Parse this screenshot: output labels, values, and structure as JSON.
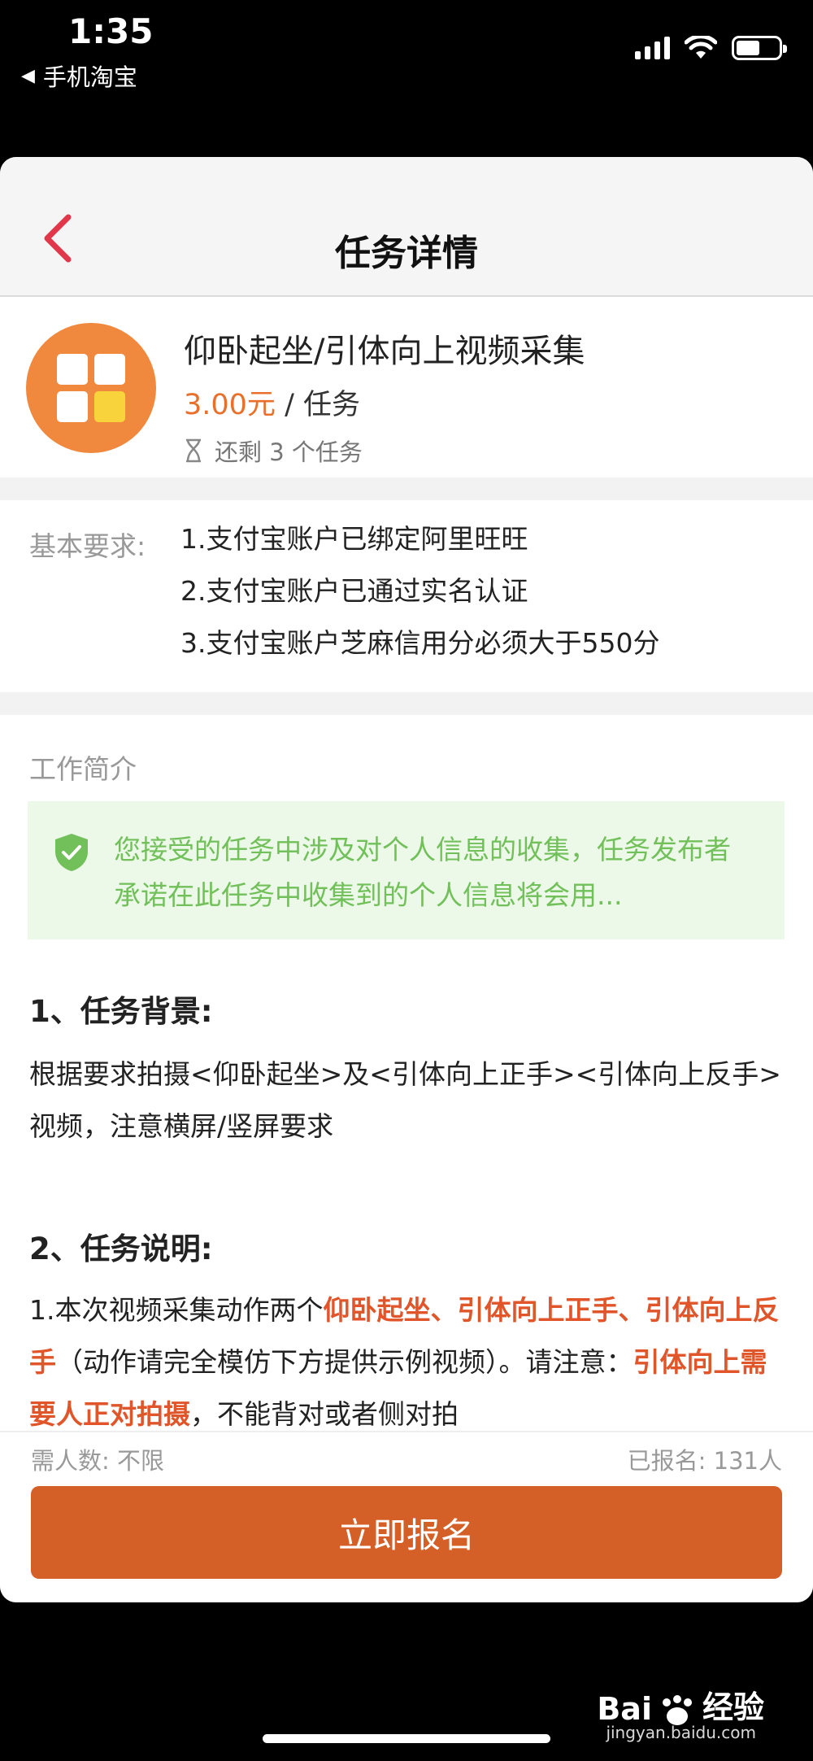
{
  "status_bar": {
    "time": "1:35",
    "back_app": "手机淘宝"
  },
  "nav": {
    "title": "任务详情"
  },
  "task": {
    "title": "仰卧起坐/引体向上视频采集",
    "price": "3.00元",
    "price_unit": " / 任务",
    "remaining": "还剩 3 个任务"
  },
  "requirements": {
    "label": "基本要求:",
    "items": [
      "1.支付宝账户已绑定阿里旺旺",
      "2.支付宝账户已通过实名认证",
      "3.支付宝账户芝麻信用分必须大于550分"
    ]
  },
  "work": {
    "title": "工作简介",
    "notice": "您接受的任务中涉及对个人信息的收集，任务发布者承诺在此任务中收集到的个人信息将会用...",
    "section1_heading": "1、任务背景:",
    "section1_text": "根据要求拍摄<仰卧起坐>及<引体向上正手><引体向上反手>视频，注意横屏/竖屏要求",
    "section2_heading": "2、任务说明:",
    "section2_p1": "1.本次视频采集动作两个",
    "section2_hl1": "仰卧起坐、引体向上正手、引体向上反手",
    "section2_p2": "（动作请完全模仿下方提供示例视频）。请注意：",
    "section2_hl2": "引体向上需要人正对拍摄",
    "section2_p3": "，不能背对或者侧对拍"
  },
  "footer": {
    "need": "需人数: 不限",
    "signed": "已报名: 131人",
    "signup_label": "立即报名"
  },
  "watermark": {
    "brand": "Bai",
    "brand2": "经验",
    "site": "jingyan.baidu.com"
  },
  "colors": {
    "accent_orange": "#e8702a",
    "button": "#d45f27",
    "notice_green": "#71c05a",
    "back_red": "#e0374a"
  }
}
